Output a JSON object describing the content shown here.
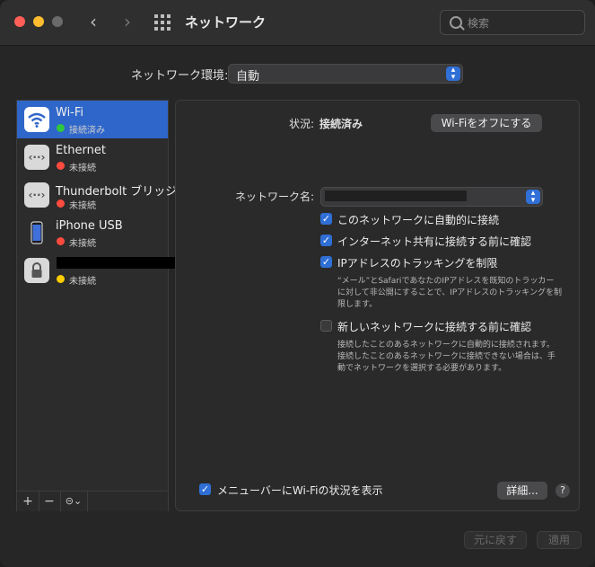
{
  "window": {
    "title": "ネットワーク"
  },
  "search": {
    "placeholder": "検索"
  },
  "location": {
    "label": "ネットワーク環境:",
    "value": "自動"
  },
  "services": [
    {
      "name": "Wi-Fi",
      "status": "接続済み",
      "status_color": "#2ec83f",
      "icon": "wifi-icon",
      "selected": true
    },
    {
      "name": "Ethernet",
      "status": "未接続",
      "status_color": "#ff4b3e",
      "icon": "ethernet-icon"
    },
    {
      "name": "Thunderbolt ブリッジ",
      "status": "未接続",
      "status_color": "#ff4b3e",
      "icon": "ethernet-icon"
    },
    {
      "name": "iPhone USB",
      "status": "未接続",
      "status_color": "#ff4b3e",
      "icon": "iphone-icon"
    },
    {
      "name": "",
      "status": "未接続",
      "status_color": "#ffcc00",
      "icon": "lock-icon"
    }
  ],
  "sidebar_footer": {
    "add": "+",
    "remove": "−",
    "more": "⊝⌄"
  },
  "detail": {
    "status_label": "状況:",
    "status_value": "接続済み",
    "toggle_wifi": "Wi-Fiをオフにする",
    "network_name_label": "ネットワーク名:",
    "options": [
      {
        "label": "このネットワークに自動的に接続",
        "checked": true
      },
      {
        "label": "インターネット共有に接続する前に確認",
        "checked": true
      },
      {
        "label": "IPアドレスのトラッキングを制限",
        "checked": true
      }
    ],
    "tracking_note": "“メール”とSafariであなたのIPアドレスを既知のトラッカーに対して非公開にすることで、IPアドレスのトラッキングを制限します。",
    "ask_new": {
      "label": "新しいネットワークに接続する前に確認",
      "checked": false
    },
    "ask_new_note": "接続したことのあるネットワークに自動的に接続されます。接続したことのあるネットワークに接続できない場合は、手動でネットワークを選択する必要があります。",
    "menubar": {
      "label": "メニューバーにWi-Fiの状況を表示",
      "checked": true
    },
    "advanced": "詳細...",
    "help": "?"
  },
  "footer": {
    "revert": "元に戻す",
    "apply": "適用"
  },
  "colors": {
    "accent": "#2f6fd6",
    "selected_row": "#2f66c9"
  }
}
